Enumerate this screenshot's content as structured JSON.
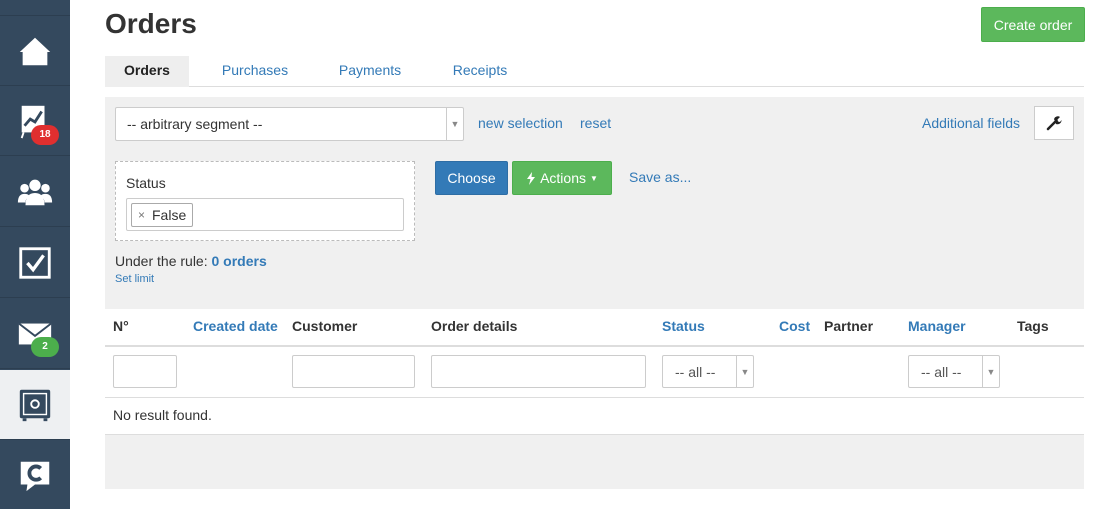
{
  "sidebar": {
    "items": [
      {
        "icon": "home-icon"
      },
      {
        "icon": "chart-icon",
        "badge": "18"
      },
      {
        "icon": "users-icon"
      },
      {
        "icon": "tasks-icon"
      },
      {
        "icon": "mail-icon",
        "badge": "2"
      },
      {
        "icon": "safe-icon"
      },
      {
        "icon": "chat-icon"
      }
    ]
  },
  "header": {
    "title": "Orders",
    "create_label": "Create order"
  },
  "tabs": [
    "Orders",
    "Purchases",
    "Payments",
    "Receipts"
  ],
  "filter": {
    "segment_value": "-- arbitrary segment --",
    "new_selection": "new selection",
    "reset": "reset",
    "additional_fields": "Additional fields",
    "status_label": "Status",
    "status_chip": "False",
    "chip_remove": "×",
    "choose": "Choose",
    "actions": "Actions",
    "save_as": "Save as...",
    "rule_prefix": "Under the rule:",
    "rule_count": "0 orders",
    "set_limit": "Set limit"
  },
  "table": {
    "columns": {
      "number": "N°",
      "created_date": "Created date",
      "customer": "Customer",
      "order_details": "Order details",
      "status": "Status",
      "cost": "Cost",
      "partner": "Partner",
      "manager": "Manager",
      "tags": "Tags"
    },
    "status_filter": "-- all --",
    "manager_filter": "-- all --",
    "empty": "No result found."
  }
}
